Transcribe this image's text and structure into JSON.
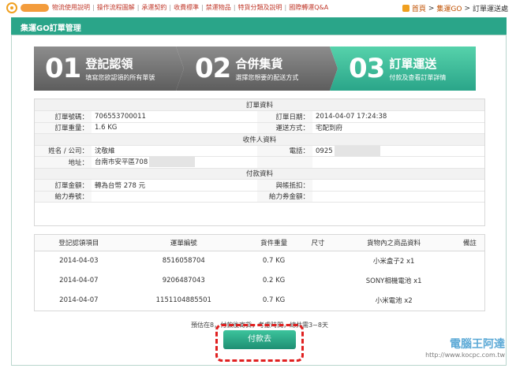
{
  "topnav": {
    "links": [
      "物流使用說明",
      "操作流程圖解",
      "承運契約",
      "收費標準",
      "禁運物品",
      "特貨分類及說明",
      "國際轉運Q&A"
    ]
  },
  "breadcrumb": {
    "home": "首頁",
    "section": "集運GO",
    "current": "訂單運送處"
  },
  "header": {
    "title": "集運GO訂單管理"
  },
  "steps": [
    {
      "num": "01",
      "title": "登記認領",
      "sub": "填寫您欲認領的所有單號"
    },
    {
      "num": "02",
      "title": "合併集貨",
      "sub": "選擇您想要的配送方式"
    },
    {
      "num": "03",
      "title": "訂單運送",
      "sub": "付款及查看訂單詳情"
    }
  ],
  "order": {
    "section_title": "訂單資料",
    "order_no_label": "訂單號碼：",
    "order_no": "706553700011",
    "order_date_label": "訂單日期：",
    "order_date": "2014-04-07 17:24:38",
    "weight_label": "訂單重量：",
    "weight": "1.6 KG",
    "ship_label": "運送方式：",
    "ship": "宅配到府"
  },
  "recipient": {
    "section_title": "收件人資料",
    "name_label": "姓名 / 公司：",
    "name": "沈敬維",
    "phone_label": "電話：",
    "phone": "0925",
    "address_label": "地址：",
    "address": "台南市安平區708"
  },
  "payment": {
    "section_title": "付款資料",
    "amount_label": "訂單金額：",
    "amount": "轉為台幣 278 元",
    "deduct_label": "與帳抵扣：",
    "coupon_label": "紿力券號：",
    "coupon_amt_label": "紿力券金額："
  },
  "items": {
    "headers": [
      "登記認領項目",
      "運單編號",
      "貨件重量",
      "尺寸",
      "貨物內之商品資料",
      "備註"
    ],
    "rows": [
      {
        "date": "2014-04-03",
        "no": "8516058704",
        "weight": "0.7 KG",
        "size": "",
        "goods": "小米盒子2 x1",
        "note": ""
      },
      {
        "date": "2014-04-07",
        "no": "9206487043",
        "weight": "0.2 KG",
        "size": "",
        "goods": "SONY相機電池 x1",
        "note": ""
      },
      {
        "date": "2014-04-07",
        "no": "1151104885501",
        "weight": "0.7 KG",
        "size": "",
        "goods": "小米電池 x2",
        "note": ""
      }
    ]
  },
  "note": "預估在8，付款後寄貨，考慮時間，總共需3~8天",
  "pay_button": "付款去",
  "watermark": {
    "name": "電腦王阿達",
    "url": "http://www.kocpc.com.tw"
  }
}
